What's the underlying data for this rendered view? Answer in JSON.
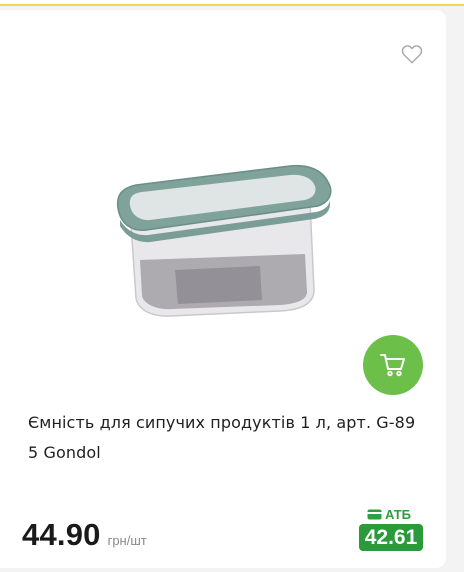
{
  "product": {
    "title": "Ємність для сипучих продуктів 1 л, арт. G-89 5 Gondol",
    "price": "44.90",
    "unit": "грн/шт",
    "promo_label": "АТБ",
    "promo_price": "42.61"
  },
  "icons": {
    "favorite": "heart-outline-icon",
    "cart": "shopping-cart-icon",
    "promo": "card-icon"
  },
  "colors": {
    "accent": "#f6d94a",
    "cart_button": "#6cc04a",
    "promo": "#2a9a3a",
    "text": "#1f1f1f",
    "unit_text": "#8a8a8a"
  }
}
